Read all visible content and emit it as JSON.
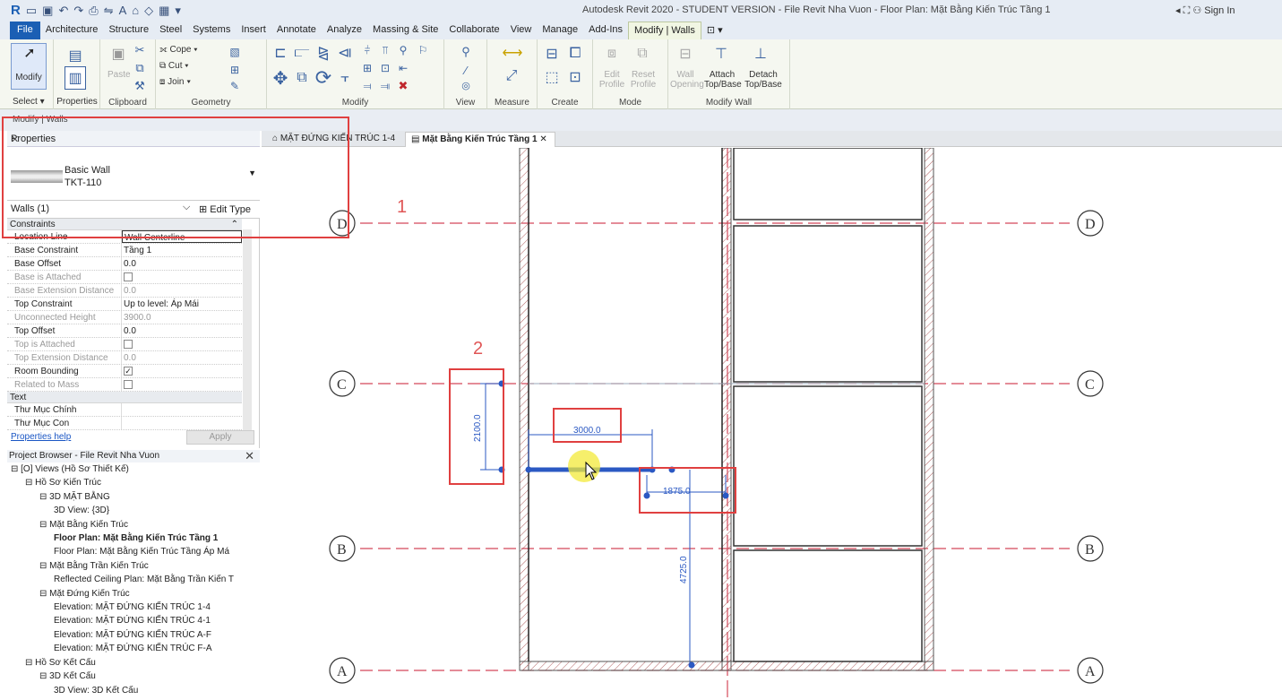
{
  "titlebar": {
    "title": "Autodesk Revit 2020 - STUDENT VERSION - File Revit Nha Vuon - Floor Plan: Mặt Bằng Kiến Trúc Tầng 1",
    "signin": "Sign In",
    "logo": "R"
  },
  "ribbon_tabs": [
    "Architecture",
    "Structure",
    "Steel",
    "Systems",
    "Insert",
    "Annotate",
    "Analyze",
    "Massing & Site",
    "Collaborate",
    "View",
    "Manage",
    "Add-Ins",
    "Modify | Walls"
  ],
  "file_tab": "File",
  "ribbon": {
    "modify": "Modify",
    "select": "Select ▾",
    "properties": "Properties",
    "clipboard": "Clipboard",
    "paste": "Paste",
    "cope": "Cope",
    "cut": "Cut",
    "join": "Join",
    "geometry": "Geometry",
    "modify_panel": "Modify",
    "view_panel": "View",
    "measure_panel": "Measure",
    "create_panel": "Create",
    "edit_profile": "Edit Profile",
    "reset_profile": "Reset Profile",
    "mode_panel": "Mode",
    "wall_opening": "Wall Opening",
    "attach": "Attach Top/Base",
    "detach": "Detach Top/Base",
    "modify_wall_panel": "Modify Wall"
  },
  "context_label": "Modify | Walls",
  "properties": {
    "title": "Properties",
    "type_family": "Basic Wall",
    "type_name": "TKT-110",
    "selector": "Walls (1)",
    "edit_type": "Edit Type",
    "help": "Properties help",
    "apply": "Apply",
    "sections": {
      "constraints": "Constraints",
      "text": "Text"
    },
    "rows": [
      {
        "k": "Location Line",
        "v": "Wall Centerline",
        "dis": false
      },
      {
        "k": "Base Constraint",
        "v": "Tầng 1",
        "dis": false
      },
      {
        "k": "Base Offset",
        "v": "0.0",
        "dis": false
      },
      {
        "k": "Base is Attached",
        "v": "",
        "dis": true
      },
      {
        "k": "Base Extension Distance",
        "v": "0.0",
        "dis": true
      },
      {
        "k": "Top Constraint",
        "v": "Up to level: Áp Mái",
        "dis": false
      },
      {
        "k": "Unconnected Height",
        "v": "3900.0",
        "dis": true
      },
      {
        "k": "Top Offset",
        "v": "0.0",
        "dis": false
      },
      {
        "k": "Top is Attached",
        "v": "",
        "dis": true
      },
      {
        "k": "Top Extension Distance",
        "v": "0.0",
        "dis": true
      },
      {
        "k": "Room Bounding",
        "v": "✓",
        "dis": false
      },
      {
        "k": "Related to Mass",
        "v": "",
        "dis": true
      }
    ],
    "text_rows": [
      {
        "k": "Thư Mục Chính",
        "v": ""
      },
      {
        "k": "Thư Mục Con",
        "v": ""
      }
    ]
  },
  "browser": {
    "title": "Project Browser - File Revit Nha Vuon",
    "items": [
      {
        "t": "⊟ [O] Views (Hồ Sơ Thiết Kế)",
        "d": 0,
        "b": false
      },
      {
        "t": "⊟ Hồ Sơ Kiến Trúc",
        "d": 1,
        "b": false
      },
      {
        "t": "⊟ 3D MẶT BẰNG",
        "d": 2,
        "b": false
      },
      {
        "t": "3D View: {3D}",
        "d": 3,
        "b": false
      },
      {
        "t": "⊟ Mặt Bằng Kiến Trúc",
        "d": 2,
        "b": false
      },
      {
        "t": "Floor Plan: Mặt Bằng Kiến Trúc Tầng 1",
        "d": 3,
        "b": true
      },
      {
        "t": "Floor Plan: Mặt Bằng Kiến Trúc Tầng Áp Má",
        "d": 3,
        "b": false
      },
      {
        "t": "⊟ Mặt Bằng Trần Kiến Trúc",
        "d": 2,
        "b": false
      },
      {
        "t": "Reflected Ceiling Plan: Mặt Bằng Trần Kiến T",
        "d": 3,
        "b": false
      },
      {
        "t": "⊟ Mặt Đứng Kiến Trúc",
        "d": 2,
        "b": false
      },
      {
        "t": "Elevation: MẶT ĐỨNG KIẾN TRÚC 1-4",
        "d": 3,
        "b": false
      },
      {
        "t": "Elevation: MẶT ĐỨNG KIẾN TRÚC 4-1",
        "d": 3,
        "b": false
      },
      {
        "t": "Elevation: MẶT ĐỨNG KIẾN TRÚC A-F",
        "d": 3,
        "b": false
      },
      {
        "t": "Elevation: MẶT ĐỨNG KIẾN TRÚC F-A",
        "d": 3,
        "b": false
      },
      {
        "t": "⊟ Hồ Sơ Kết Cấu",
        "d": 1,
        "b": false
      },
      {
        "t": "⊟ 3D Kết Cấu",
        "d": 2,
        "b": false
      },
      {
        "t": "3D View: 3D Kết Cấu",
        "d": 3,
        "b": false
      }
    ]
  },
  "view_tabs": [
    {
      "label": "MẶT ĐỨNG KIẾN TRÚC 1-4",
      "active": false
    },
    {
      "label": "Mặt Bằng Kiến Trúc Tầng 1",
      "active": true
    }
  ],
  "canvas": {
    "grids": [
      "D",
      "C",
      "B",
      "A"
    ],
    "dims": {
      "d3000": "3000.0",
      "d1875": "1875.0",
      "d2100": "2100.0",
      "d4725": "4725.0"
    },
    "annotations": [
      "1",
      "2"
    ]
  },
  "colors": {
    "accent": "#1b5fb4",
    "grid_line": "#d4485a",
    "highlight": "#e04040",
    "selected_wall": "#2b59c3"
  }
}
